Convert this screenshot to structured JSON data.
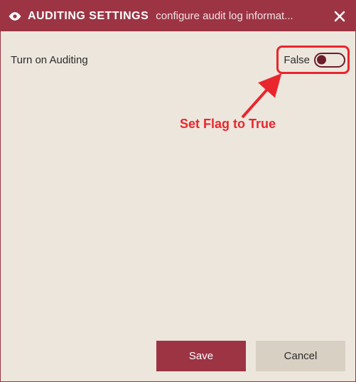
{
  "colors": {
    "brand": "#9c3444",
    "brand_dark": "#6c1e2c",
    "panel_bg": "#ede6dd",
    "annotation": "#e9262d",
    "secondary_btn": "#d8d1c3"
  },
  "header": {
    "title": "AUDITING SETTINGS",
    "subtitle": "configure audit log informat...",
    "close_icon": "close-icon",
    "title_icon": "eye-icon"
  },
  "settings": {
    "auditing": {
      "label": "Turn on Auditing",
      "state_text": "False",
      "value": false
    }
  },
  "annotation": {
    "text": "Set Flag to True"
  },
  "buttons": {
    "save": "Save",
    "cancel": "Cancel"
  }
}
